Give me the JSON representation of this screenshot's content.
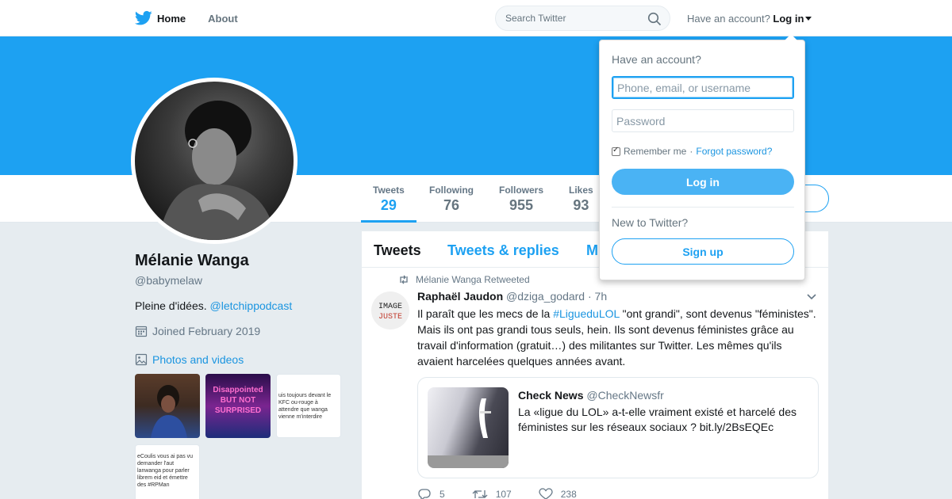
{
  "nav": {
    "home_label": "Home",
    "about_label": "About",
    "search_placeholder": "Search Twitter",
    "have_account": "Have an account?",
    "login_label": "Log in"
  },
  "colors": {
    "brand": "#1da1f2",
    "banner": "#1da1f2",
    "link": "#1b95e0"
  },
  "profile": {
    "name": "Mélanie Wanga",
    "handle": "@babymelaw",
    "bio_text": "Pleine d'idées. ",
    "bio_link": "@letchippodcast",
    "joined": "Joined February 2019",
    "photos_label": "Photos and videos",
    "thumbs": [
      {
        "text": ""
      },
      {
        "text": "Disappointed BUT NOT SURPRISED"
      },
      {
        "text": "uis toujours devant le KFC ou-rouge à attendre que wanga vienne m'interdire"
      },
      {
        "text": "eCoulis vous ai pas vu demander l'aut lanwanga pour parler librem eid et émettre des #RPMan"
      }
    ]
  },
  "stats": [
    {
      "label": "Tweets",
      "value": "29"
    },
    {
      "label": "Following",
      "value": "76"
    },
    {
      "label": "Followers",
      "value": "955"
    },
    {
      "label": "Likes",
      "value": "93"
    }
  ],
  "timeline": {
    "tabs": [
      "Tweets",
      "Tweets & replies",
      "M"
    ],
    "retweeted_by": "Mélanie Wanga Retweeted",
    "tweet": {
      "author": "Raphaël Jaudon",
      "handle": "@dziga_godard",
      "time": "· 7h",
      "avatar_text_1": "IMAGE",
      "avatar_text_2": "JUSTE",
      "text_before": "Il paraît que les mecs de la ",
      "hashtag": "#LigueduLOL",
      "text_after": " \"ont grandi\", sont devenus \"féministes\". Mais ils ont pas grandi tous seuls, hein. Ils sont devenus féministes grâce au travail d'information (gratuit…) des militantes sur Twitter. Les mêmes qu'ils avaient harcelées quelques années avant.",
      "card": {
        "name": "Check News",
        "handle": "@CheckNewsfr",
        "text": "La «ligue du LOL» a-t-elle vraiment existé et harcelé des féministes sur les réseaux sociaux ? bit.ly/2BsEQEc"
      },
      "replies": "5",
      "retweets": "107",
      "likes": "238"
    }
  },
  "login_dropdown": {
    "title": "Have an account?",
    "username_placeholder": "Phone, email, or username",
    "password_placeholder": "Password",
    "remember": "Remember me",
    "separator": " · ",
    "forgot": "Forgot password?",
    "login_button": "Log in",
    "new_to": "New to Twitter?",
    "signup_button": "Sign up"
  }
}
